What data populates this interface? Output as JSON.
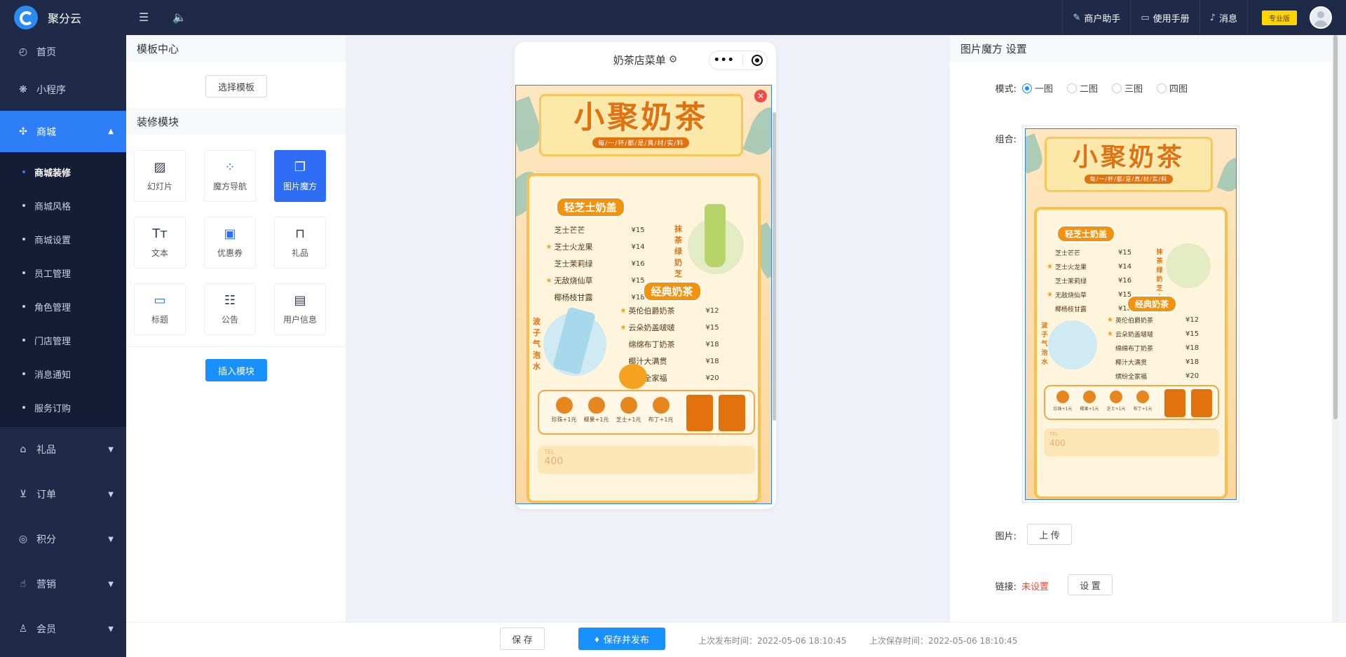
{
  "topbar": {
    "logo_text": "聚分云",
    "items": [
      {
        "label": "商户助手",
        "icon": "wrench-icon"
      },
      {
        "label": "使用手册",
        "icon": "book-icon"
      },
      {
        "label": "消息",
        "icon": "bell-icon"
      }
    ],
    "badge": "专业版"
  },
  "sidebar": {
    "items": [
      {
        "label": "首页",
        "icon": "dashboard-icon"
      },
      {
        "label": "小程序",
        "icon": "wechat-icon"
      },
      {
        "label": "商城",
        "icon": "shop-icon",
        "active": true
      }
    ],
    "sub_items": [
      {
        "label": "商城装修",
        "active": true
      },
      {
        "label": "商城风格"
      },
      {
        "label": "商城设置"
      },
      {
        "label": "员工管理"
      },
      {
        "label": "角色管理"
      },
      {
        "label": "门店管理"
      },
      {
        "label": "消息通知"
      },
      {
        "label": "服务订购"
      }
    ],
    "groups": [
      {
        "label": "礼品",
        "icon": "gift-icon"
      },
      {
        "label": "订单",
        "icon": "cart-icon"
      },
      {
        "label": "积分",
        "icon": "coins-icon"
      },
      {
        "label": "营销",
        "icon": "thumb-icon"
      },
      {
        "label": "会员",
        "icon": "user-icon"
      }
    ]
  },
  "left_panel": {
    "template_title": "模板中心",
    "choose_label": "选择模板",
    "modules_title": "装修模块",
    "modules": [
      {
        "label": "幻灯片",
        "icon": "image-icon"
      },
      {
        "label": "魔方导航",
        "icon": "grid-icon"
      },
      {
        "label": "图片魔方",
        "icon": "gallery-icon",
        "active": true
      },
      {
        "label": "文本",
        "icon": "text-icon"
      },
      {
        "label": "优惠券",
        "icon": "coupon-icon"
      },
      {
        "label": "礼品",
        "icon": "bag-icon"
      },
      {
        "label": "标题",
        "icon": "title-icon"
      },
      {
        "label": "公告",
        "icon": "notice-icon"
      },
      {
        "label": "用户信息",
        "icon": "id-card-icon"
      }
    ],
    "insert_label": "插入模块"
  },
  "phone": {
    "title": "奶茶店菜单"
  },
  "poster": {
    "title": "小聚奶茶",
    "subtitle": "每/一/杯/都/是/真/材/实/料",
    "section1": "轻芝士奶盖",
    "section1_items": [
      {
        "name": "芝士芒芒",
        "price": "¥15",
        "star": false
      },
      {
        "name": "芝士火龙果",
        "price": "¥14",
        "star": true
      },
      {
        "name": "芝士茉莉绿",
        "price": "¥16",
        "star": false
      },
      {
        "name": "无敌烧仙草",
        "price": "¥15",
        "star": true
      },
      {
        "name": "椰杨枝甘露",
        "price": "¥18",
        "star": false
      }
    ],
    "vert1": "抹茶绿奶芝士",
    "section2": "经典奶茶",
    "section2_items": [
      {
        "name": "英伦伯爵奶茶",
        "price": "¥12",
        "star": true
      },
      {
        "name": "云朵奶盖啵啵",
        "price": "¥15",
        "star": true
      },
      {
        "name": "绵绵布丁奶茶",
        "price": "¥18",
        "star": false
      },
      {
        "name": "椰汁大满贯",
        "price": "¥18",
        "star": false
      },
      {
        "name": "缤纷全家福",
        "price": "¥20",
        "star": false
      }
    ],
    "vert2": "波子气泡水",
    "toppings": [
      {
        "name": "珍珠+1元"
      },
      {
        "name": "椰果+1元"
      },
      {
        "name": "芝士+1元"
      },
      {
        "name": "布丁+1元"
      }
    ],
    "tel_label": "TEL",
    "tel_value": "400"
  },
  "right_panel": {
    "title": "图片魔方 设置",
    "mode_label": "模式:",
    "modes": [
      {
        "label": "一图",
        "checked": true
      },
      {
        "label": "二图"
      },
      {
        "label": "三图"
      },
      {
        "label": "四图"
      }
    ],
    "combo_label": "组合:",
    "image_label": "图片:",
    "upload_label": "上 传",
    "link_label": "链接:",
    "link_value": "未设置",
    "set_label": "设 置"
  },
  "bottombar": {
    "save_label": "保 存",
    "publish_label": "保存并发布",
    "last_publish": "上次发布时间：2022-05-06 18:10:45",
    "last_save": "上次保存时间：2022-05-06 18:10:45"
  }
}
